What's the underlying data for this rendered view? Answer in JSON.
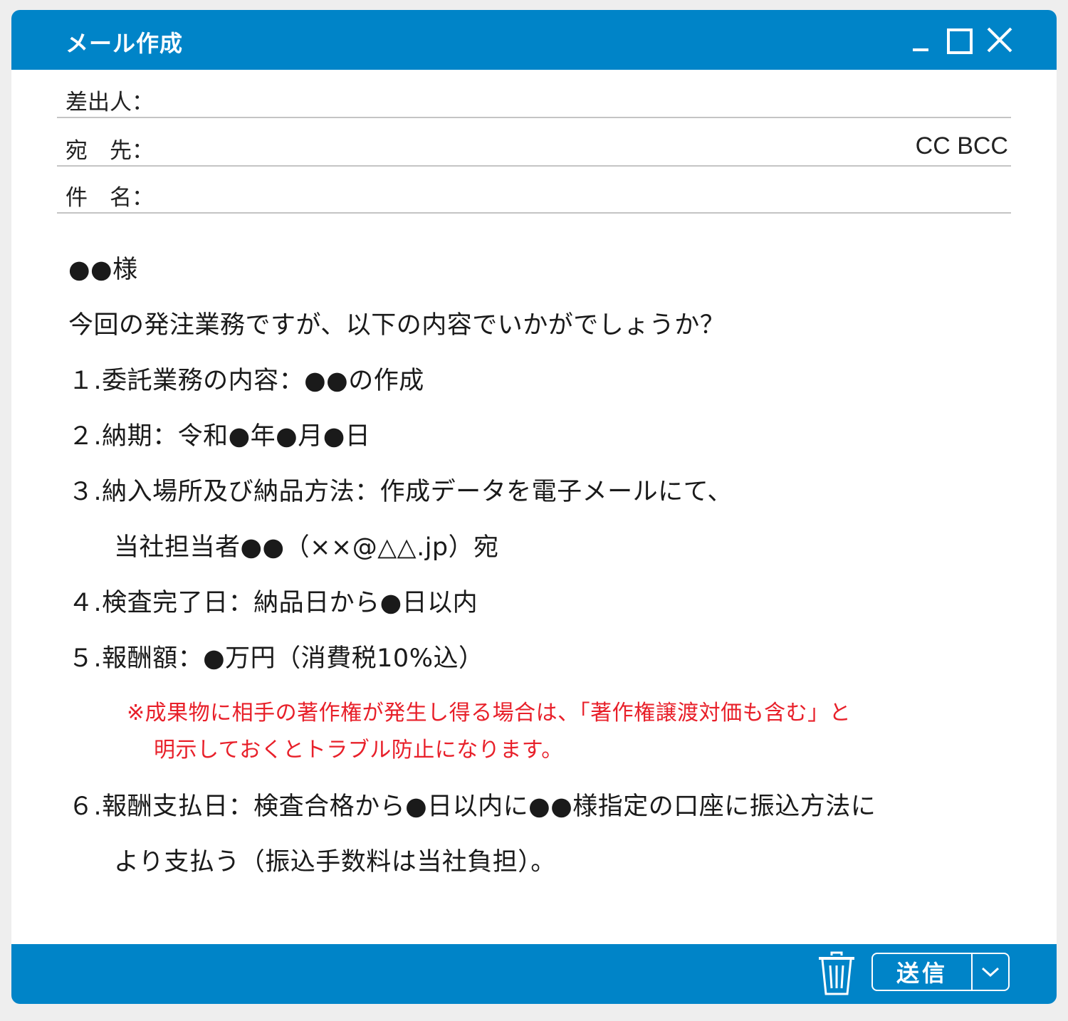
{
  "window": {
    "title": "メール作成"
  },
  "header": {
    "from_label": "差出人：",
    "to_label": "宛　先：",
    "subject_label": "件　名：",
    "cc_label": "CC",
    "bcc_label": "BCC"
  },
  "body": {
    "greeting": "●●様",
    "intro": "今回の発注業務ですが、以下の内容でいかがでしょうか？",
    "item1": "１.委託業務の内容：●●の作成",
    "item2": "２.納期：令和●年●月●日",
    "item3_line1": "３.納入場所及び納品方法：作成データを電子メールにて、",
    "item3_line2": "当社担当者●●（××@△△.jp）宛",
    "item4": "４.検査完了日：納品日から●日以内",
    "item5": "５.報酬額：●万円（消費税10%込）",
    "note_line1": "※成果物に相手の著作権が発生し得る場合は、「著作権譲渡対価も含む」と",
    "note_line2": "明示しておくとトラブル防止になります。",
    "item6_line1": "６.報酬支払日：検査合格から●日以内に●●様指定の口座に振込方法に",
    "item6_line2": "より支払う（振込手数料は当社負担）。"
  },
  "footer": {
    "send_label": "送信",
    "trash_icon": "trash-icon",
    "dropdown_icon": "chevron-down-icon"
  },
  "colors": {
    "accent": "#0084c8",
    "note": "#e8202a",
    "background": "#eeeeee",
    "divider": "#c4c4c4"
  }
}
